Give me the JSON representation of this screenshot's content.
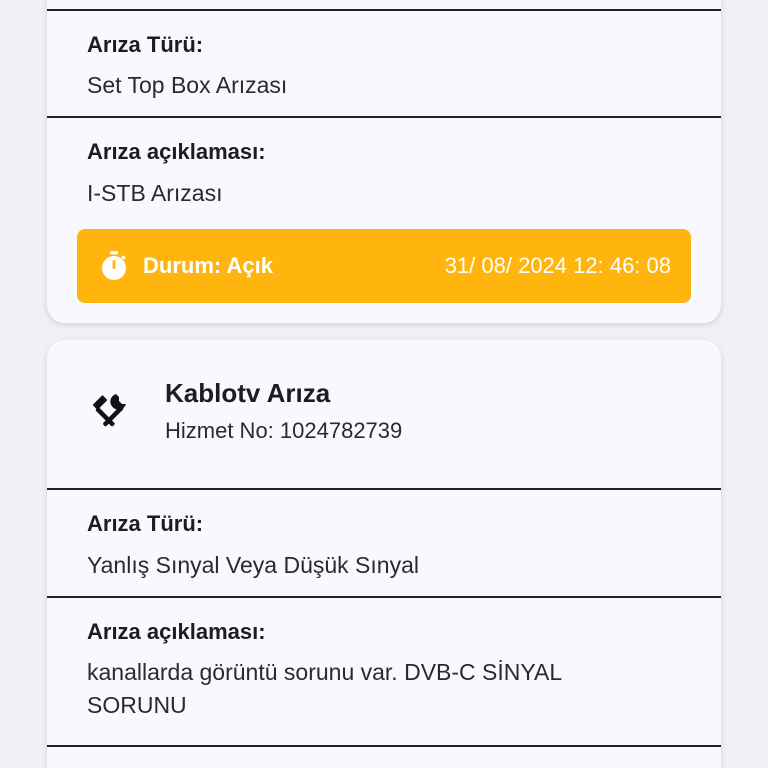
{
  "card1": {
    "fault_type_label": "Arıza Türü:",
    "fault_type_value": "Set Top Box Arızası",
    "fault_desc_label": "Arıza açıklaması:",
    "fault_desc_value": "I-STB Arızası",
    "status_label": "Durum: Açık",
    "status_datetime": "31/ 08/ 2024 12: 46: 08",
    "status_icon": "stopwatch-icon",
    "status_color": "#ffb50d"
  },
  "card2": {
    "icon": "tools-icon",
    "title": "Kablotv Arıza",
    "service_no": "Hizmet No: 1024782739",
    "fault_type_label": "Arıza Türü:",
    "fault_type_value": "Yanlış Sınyal Veya Düşük Sınyal",
    "fault_desc_label": "Arıza açıklaması:",
    "fault_desc_line1": "kanallarda görüntü sorunu var. DVB-C SİNYAL",
    "fault_desc_line2": "SORUNU"
  }
}
